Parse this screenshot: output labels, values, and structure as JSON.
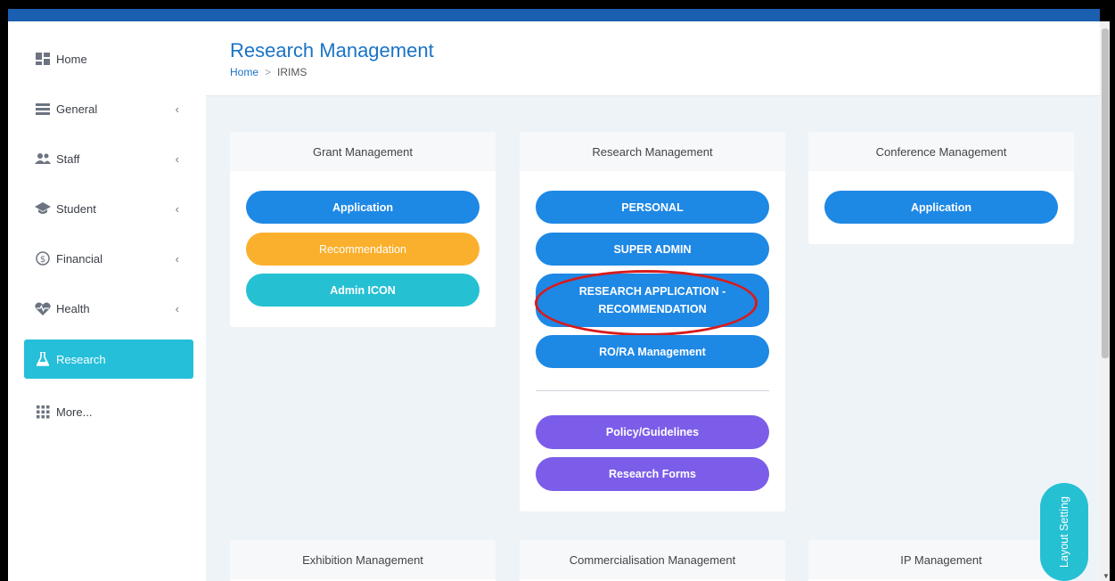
{
  "sidebar": {
    "items": [
      {
        "label": "Home",
        "icon": "dashboard-icon",
        "chevron": ""
      },
      {
        "label": "General",
        "icon": "list-icon",
        "chevron": "‹"
      },
      {
        "label": "Staff",
        "icon": "users-icon",
        "chevron": "‹"
      },
      {
        "label": "Student",
        "icon": "graduation-cap-icon",
        "chevron": "‹"
      },
      {
        "label": "Financial",
        "icon": "dollar-circle-icon",
        "chevron": "‹"
      },
      {
        "label": "Health",
        "icon": "heartbeat-icon",
        "chevron": "‹"
      },
      {
        "label": "Research",
        "icon": "flask-icon",
        "chevron": ""
      },
      {
        "label": "More...",
        "icon": "grid-icon",
        "chevron": ""
      }
    ],
    "active": "Research"
  },
  "header": {
    "title": "Research Management",
    "breadcrumb": {
      "home": "Home",
      "separator": ">",
      "current": "IRIMS"
    }
  },
  "cards": {
    "grant": {
      "title": "Grant Management",
      "buttons": [
        "Application",
        "Recommendation",
        "Admin ICON"
      ]
    },
    "research": {
      "title": "Research Management",
      "buttons": [
        "PERSONAL",
        "SUPER ADMIN",
        "RESEARCH APPLICATION -",
        "RECOMMENDATION",
        "RO/RA Management"
      ],
      "secondary_buttons": [
        "Policy/Guidelines",
        "Research Forms"
      ]
    },
    "conference": {
      "title": "Conference Management",
      "buttons": [
        "Application"
      ]
    },
    "exhibition": {
      "title": "Exhibition Management"
    },
    "commercialisation": {
      "title": "Commercialisation Management"
    },
    "ip": {
      "title": "IP Management"
    }
  },
  "layout_setting": "Layout Setting",
  "colors": {
    "primary_blue": "#1e88e5",
    "orange": "#fbb02d",
    "teal": "#26c0d3",
    "purple": "#7c5de9",
    "highlight_red": "#d81b1b",
    "topbar": "#1b5fb0"
  }
}
